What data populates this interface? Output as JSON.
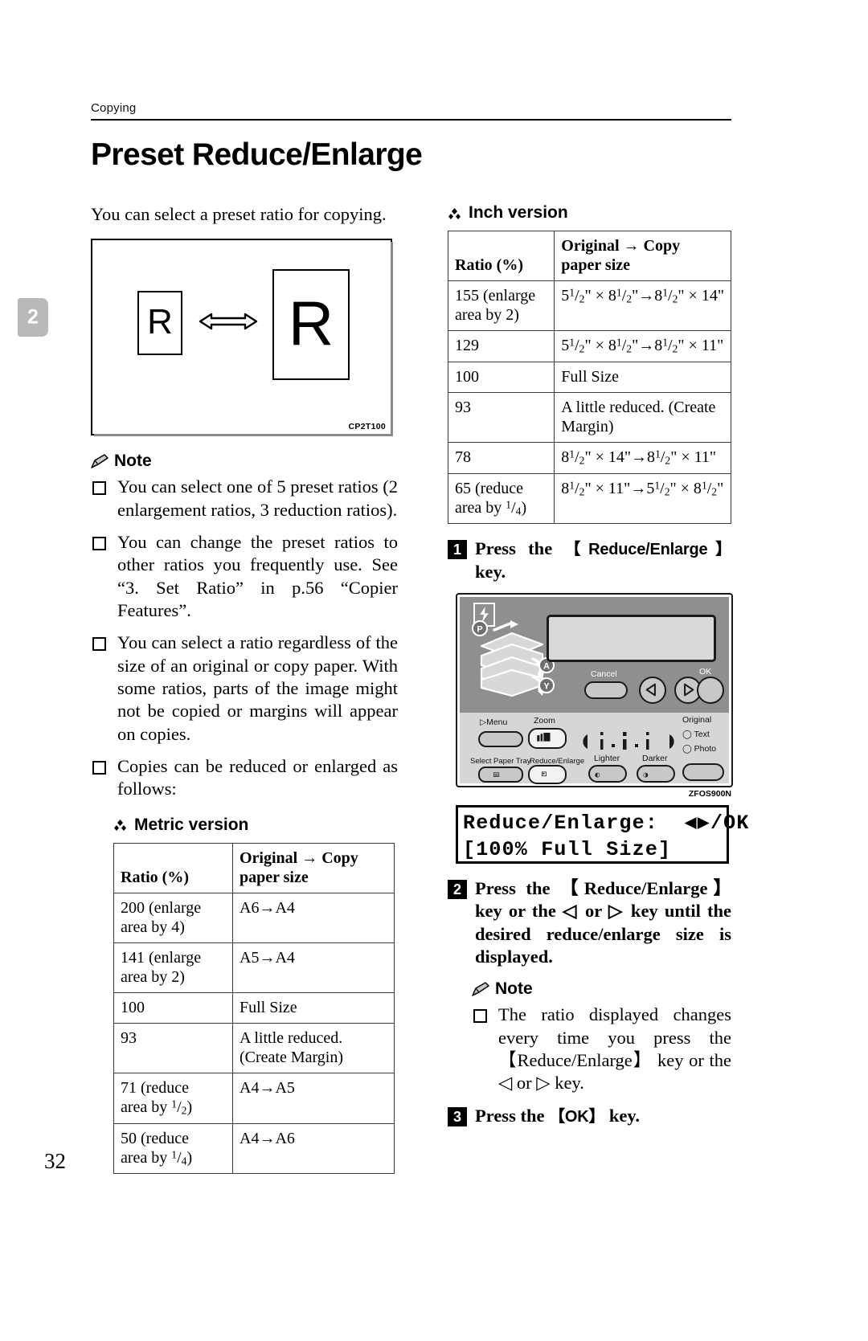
{
  "running_head": "Copying",
  "title": "Preset Reduce/Enlarge",
  "chapter_tab": "2",
  "page_number": "32",
  "left": {
    "intro": "You can select a preset ratio for copying.",
    "figure": {
      "letter_small": "R",
      "letter_large": "R",
      "code": "CP2T100",
      "arrow_icon": "double-arrow-icon"
    },
    "note_label": "Note",
    "notes": [
      "You can select one of 5 preset ratios (2 enlargement ratios, 3 reduction ratios).",
      "You can change the preset ratios to other ratios you frequently use. See “3. Set Ratio” in p.56 “Copier Features”.",
      "You can select a ratio regardless of the size of an original or copy paper. With some ratios, parts of the image might not be copied or margins will appear on copies.",
      "Copies can be reduced or enlarged as follows:"
    ],
    "metric_heading": "Metric version",
    "metric_table": {
      "headers": [
        "Ratio (%)",
        "Original → Copy paper size"
      ],
      "rows": [
        [
          "200 (enlarge area by 4)",
          "A6→A4"
        ],
        [
          "141 (enlarge area by 2)",
          "A5→A4"
        ],
        [
          "100",
          "Full Size"
        ],
        [
          "93",
          "A little reduced. (Create Margin)"
        ],
        [
          "71 (reduce area by ¹/₂)",
          "A4→A5"
        ],
        [
          "50 (reduce area by ¹/₄)",
          "A4→A6"
        ]
      ]
    }
  },
  "right": {
    "inch_heading": "Inch version",
    "inch_table": {
      "headers": [
        "Ratio (%)",
        "Original → Copy paper size"
      ],
      "rows": [
        [
          "155 (enlarge area by 2)",
          "5¹/₂\" × 8¹/₂\"→8¹/₂\" × 14\""
        ],
        [
          "129",
          "5¹/₂\" × 8¹/₂\"→8¹/₂\" × 11\""
        ],
        [
          "100",
          "Full Size"
        ],
        [
          "93",
          "A little reduced. (Create Margin)"
        ],
        [
          "78",
          "8¹/₂\" × 14\"→8¹/₂\" × 11\""
        ],
        [
          "65 (reduce area by ¹/₄)",
          "8¹/₂\" × 11\"→5¹/₂\" × 8¹/₂\""
        ]
      ]
    },
    "steps": [
      {
        "num": "1",
        "text_before": "Press the ",
        "key": "【Reduce/Enlarge】",
        "text_after": " key."
      },
      {
        "num": "2",
        "text": "Press the 【Reduce/Enlarge】 key or the ◁ or ▷ key until the desired reduce/enlarge size is displayed."
      },
      {
        "num": "3",
        "text_before": "Press the ",
        "key": "【OK】",
        "text_after": " key."
      }
    ],
    "panel": {
      "code": "ZFOS900N",
      "labels": {
        "cancel": "Cancel",
        "ok": "OK",
        "menu": "Menu",
        "zoom": "Zoom",
        "select_paper_tray": "Select Paper Tray",
        "reduce_enlarge": "Reduce/Enlarge",
        "lighter": "Lighter",
        "darker": "Darker",
        "original": "Original",
        "text": "Text",
        "photo": "Photo",
        "p_mark": "P",
        "a_mark": "A",
        "y_mark": "Y"
      }
    },
    "lcd": {
      "line1": "Reduce/Enlarge:  ◀▶/OK",
      "line2": "[100% Full Size]"
    },
    "note_label": "Note",
    "notes": [
      "The ratio displayed changes every time you press the 【Reduce/Enlarge】 key or the ◁ or ▷ key."
    ]
  }
}
